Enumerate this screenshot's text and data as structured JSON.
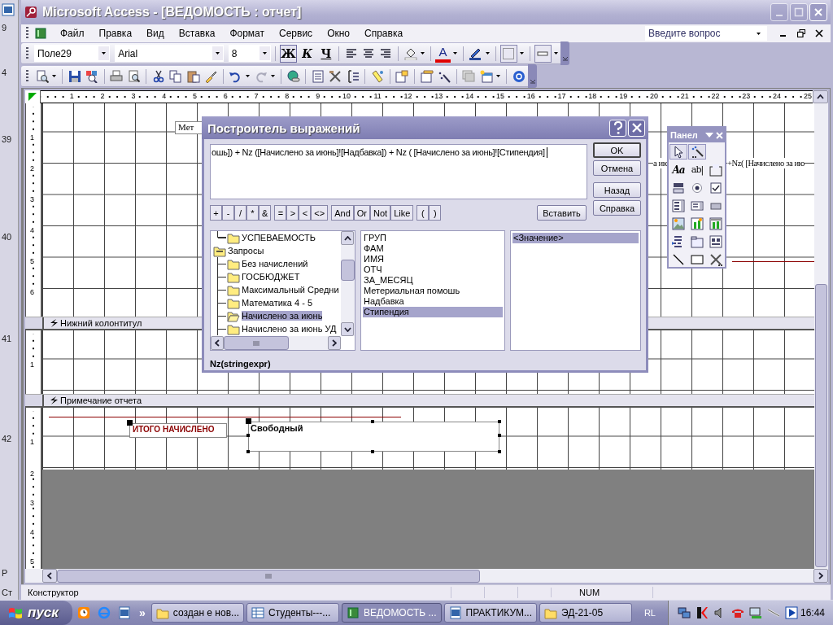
{
  "behind_window": {
    "labels": [
      "9",
      "4",
      "39",
      "40",
      "41",
      "42",
      "Р",
      "Ст"
    ]
  },
  "window": {
    "title": "Microsoft Access - [ВЕДОМОСТЬ : отчет]"
  },
  "menu": [
    "Файл",
    "Правка",
    "Вид",
    "Вставка",
    "Формат",
    "Сервис",
    "Окно",
    "Справка"
  ],
  "help_search": {
    "placeholder": "Введите вопрос"
  },
  "format_toolbar": {
    "object": "Поле29",
    "font": "Arial",
    "size": "8",
    "styles": [
      {
        "glyph": "Ж",
        "pressed": true
      },
      {
        "glyph": "К",
        "pressed": false
      },
      {
        "glyph": "Ч",
        "pressed": false
      }
    ],
    "font_color": {
      "glyph": "A"
    }
  },
  "report": {
    "ruler": [
      "1",
      "2",
      "3",
      "4",
      "5",
      "6",
      "7",
      "8",
      "9",
      "10",
      "11",
      "12",
      "13",
      "14",
      "15",
      "16",
      "17",
      "18",
      "19",
      "20",
      "21",
      "22",
      "23",
      "24",
      "25"
    ],
    "sections": [
      {
        "kind": "grid",
        "ruler_marks": [
          "1",
          "2",
          "3",
          "4",
          "5",
          "6"
        ],
        "items": [
          {
            "kind": "label",
            "text": "Мет",
            "selected": false
          },
          {
            "kind": "text",
            "text": "а ию"
          },
          {
            "kind": "text",
            "text": "+Nz( [Начислено за ию"
          },
          {
            "kind": "line"
          }
        ]
      },
      {
        "kind": "band",
        "title": "Нижний колонтитул"
      },
      {
        "kind": "grid",
        "ruler_marks": [
          "1"
        ]
      },
      {
        "kind": "band",
        "title": "Примечание отчета"
      },
      {
        "kind": "grid",
        "ruler_marks": [
          "1"
        ],
        "items": [
          {
            "kind": "line"
          },
          {
            "kind": "label",
            "text": "ИТОГО НАЧИСЛЕНО",
            "selected": true
          },
          {
            "kind": "textbox",
            "text": "Свободный",
            "selected": true
          }
        ]
      },
      {
        "kind": "empty",
        "ruler_marks": [
          "2",
          "3",
          "4",
          "5"
        ]
      }
    ]
  },
  "expression_builder": {
    "title": "Построитель выражений",
    "expression": "ошь]) + Nz ([Начислено за июнь]![Надбавка]) + Nz ( [Начислено за июнь]![Стипендия]",
    "side_buttons": [
      "OK",
      "Отмена",
      "Назад",
      "Справка"
    ],
    "insert_button": "Вставить",
    "operators": [
      "+",
      "-",
      "/",
      "*",
      "&",
      "=",
      ">",
      "<",
      "<>",
      "And",
      "Or",
      "Not",
      "Like",
      "(",
      ")"
    ],
    "tree": [
      {
        "label": "УСПЕВАЕМОСТЬ",
        "selected": false
      },
      {
        "label": "Запросы",
        "selected": false,
        "expanded": true,
        "children": [
          {
            "label": "Без начислений",
            "selected": false
          },
          {
            "label": "ГОСБЮДЖЕТ",
            "selected": false
          },
          {
            "label": "Максимальный Средни",
            "selected": false
          },
          {
            "label": "Математика 4 - 5",
            "selected": false
          },
          {
            "label": "Начислено за июнь",
            "selected": true
          },
          {
            "label": "Начислено за июнь УД",
            "selected": false
          }
        ]
      }
    ],
    "fields": [
      {
        "label": "ГРУП",
        "selected": false
      },
      {
        "label": "ФАМ",
        "selected": false
      },
      {
        "label": "ИМЯ",
        "selected": false
      },
      {
        "label": "ОТЧ",
        "selected": false
      },
      {
        "label": "ЗА_МЕСЯЦ",
        "selected": false
      },
      {
        "label": "Метериальная помошь",
        "selected": false
      },
      {
        "label": "Надбавка",
        "selected": false
      },
      {
        "label": "Стипендия",
        "selected": true
      }
    ],
    "values": [
      {
        "label": "<Значение>",
        "selected": true
      }
    ],
    "syntax": "Nz(stringexpr)"
  },
  "toolbox": {
    "title": "Панел",
    "tools": [
      {
        "kind": "pointer",
        "selected": true
      },
      {
        "kind": "wizard",
        "selected": true
      },
      {
        "kind": "label",
        "glyph": "Aa",
        "selected": false
      },
      {
        "kind": "textbox",
        "glyph": "ab|",
        "selected": false
      },
      {
        "kind": "group",
        "selected": false
      },
      {
        "kind": "toggle",
        "selected": false
      },
      {
        "kind": "radio",
        "selected": false
      },
      {
        "kind": "checkbox",
        "selected": false
      },
      {
        "kind": "combo",
        "selected": false
      },
      {
        "kind": "list",
        "selected": false
      },
      {
        "kind": "command",
        "selected": false
      },
      {
        "kind": "image",
        "selected": false
      },
      {
        "kind": "object",
        "selected": false
      },
      {
        "kind": "bound",
        "selected": false
      },
      {
        "kind": "pagebreak",
        "selected": false
      },
      {
        "kind": "tab",
        "selected": false
      },
      {
        "kind": "subform",
        "selected": false
      },
      {
        "kind": "line",
        "selected": false
      },
      {
        "kind": "rect",
        "selected": false
      },
      {
        "kind": "more",
        "selected": false
      }
    ]
  },
  "status_bar": {
    "mode": "Конструктор",
    "indicator": "NUM"
  },
  "taskbar": {
    "start": "пуск",
    "chevron": "»",
    "tasks": [
      {
        "label": "создан е нов...",
        "kind": "folder",
        "selected": false
      },
      {
        "label": "Студенты---...",
        "kind": "table",
        "selected": false
      },
      {
        "label": "ВЕДОМОСТЬ ...",
        "kind": "access",
        "selected": true
      },
      {
        "label": "ПРАКТИКУМ...",
        "kind": "word",
        "selected": false
      },
      {
        "label": "ЭД-21-05",
        "kind": "folder",
        "selected": false
      }
    ],
    "language": "RL",
    "clock": "16:44"
  }
}
